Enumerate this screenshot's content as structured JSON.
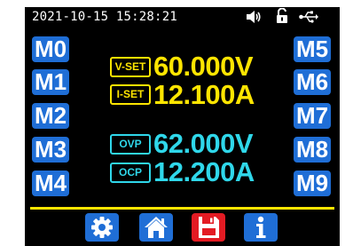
{
  "status_bar": {
    "datetime": "2021-10-15 15:28:21",
    "icons": [
      "speaker-icon",
      "unlock-icon",
      "usb-icon"
    ]
  },
  "memory_left": [
    "M0",
    "M1",
    "M2",
    "M3",
    "M4"
  ],
  "memory_right": [
    "M5",
    "M6",
    "M7",
    "M8",
    "M9"
  ],
  "readings": {
    "vset": {
      "label": "V-SET",
      "value": "60.000V"
    },
    "iset": {
      "label": "I-SET",
      "value": "12.100A"
    },
    "ovp": {
      "label": "OVP",
      "value": "62.000V"
    },
    "ocp": {
      "label": "OCP",
      "value": "12.200A"
    }
  },
  "toolbar": [
    "gear-icon",
    "home-icon",
    "save-icon",
    "info-icon"
  ],
  "colors": {
    "background": "#000000",
    "set_color": "#ffe500",
    "protect_color": "#2fd7ea",
    "memory_button": "#1f6ed6",
    "save_button": "#e31b23"
  }
}
